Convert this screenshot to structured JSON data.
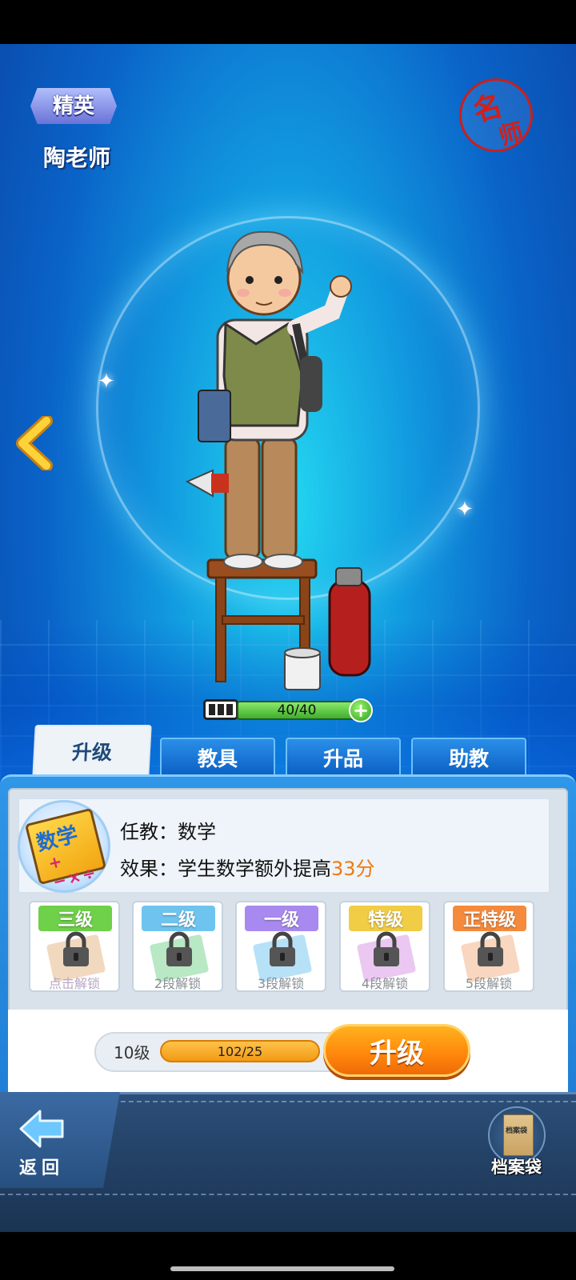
{
  "header": {
    "rank": "精英",
    "teacher_name": "陶老师",
    "famous_seal": [
      "名",
      "师"
    ]
  },
  "energy": {
    "value": "40/40",
    "plus": "+"
  },
  "tabs": [
    {
      "label": "升级",
      "active": true
    },
    {
      "label": "教具",
      "active": false
    },
    {
      "label": "升品",
      "active": false
    },
    {
      "label": "助教",
      "active": false
    }
  ],
  "subject_book": {
    "title": "数学",
    "symbols": "+−×÷"
  },
  "info": {
    "subject_label": "任教：",
    "subject_value": "数学",
    "effect_label": "效果：",
    "effect_text": "学生数学额外提高",
    "effect_value": "33分"
  },
  "grades": [
    {
      "label": "三级",
      "unlock": "点击解锁",
      "color": "#6fd04a",
      "book": "#e6b98a"
    },
    {
      "label": "二级",
      "unlock": "2段解锁",
      "color": "#6fc4ef",
      "book": "#7ed693"
    },
    {
      "label": "一级",
      "unlock": "3段解锁",
      "color": "#a889ef",
      "book": "#7cc8f0"
    },
    {
      "label": "特级",
      "unlock": "4段解锁",
      "color": "#f1cc45",
      "book": "#d99be8"
    },
    {
      "label": "正特级",
      "unlock": "5段解锁",
      "color": "#f58a3c",
      "book": "#f4b48a"
    }
  ],
  "level": {
    "level_text": "10级",
    "xp": "102/25"
  },
  "upgrade_button": "升级",
  "bottom": {
    "back_label": "返回",
    "archive_icon_text": "档案袋",
    "archive_label": "档案袋"
  },
  "colors": {
    "accent_orange": "#ee7a0f",
    "stage_blue": "#129be0",
    "panel_blue": "#1f7fd6"
  }
}
